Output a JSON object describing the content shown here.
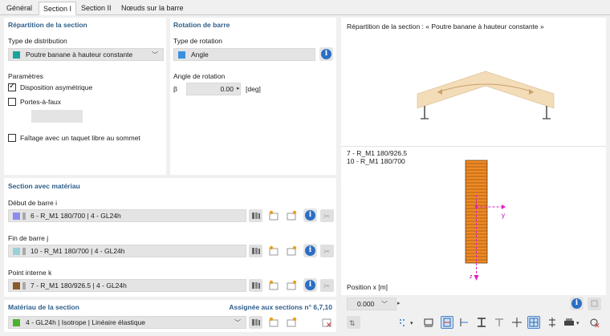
{
  "tabs": [
    "Général",
    "Section I",
    "Section II",
    "Nœuds sur la barre"
  ],
  "distribution": {
    "title": "Répartition de la section",
    "type_label": "Type de distribution",
    "type_value": "Poutre banane à hauteur constante",
    "type_color": "#1aa39a",
    "params_label": "Paramètres",
    "asym_label": "Disposition asymétrique",
    "asym_checked": true,
    "cantilever_label": "Portes-à-faux",
    "cantilever_checked": false,
    "ridge_label": "Faîtage avec un taquet libre au sommet",
    "ridge_checked": false
  },
  "rotation": {
    "title": "Rotation de barre",
    "type_label": "Type de rotation",
    "type_value": "Angle",
    "type_color": "#3b8fe0",
    "angle_label": "Angle de rotation",
    "beta_symbol": "β",
    "angle_value": "0.00",
    "angle_unit": "[deg]"
  },
  "section_material": {
    "title": "Section avec matériau",
    "start_label": "Début de barre i",
    "start_value": "6 - R_M1 180/700 | 4 - GL24h",
    "start_color": "#8c8cf0",
    "end_label": "Fin de barre j",
    "end_value": "10 - R_M1 180/700 | 4 - GL24h",
    "end_color": "#9ad0d8",
    "internal_label": "Point interne k",
    "internal_value": "7 - R_M1 180/926.5 | 4 - GL24h",
    "internal_color": "#8a5a2a"
  },
  "material": {
    "title": "Matériau de la section",
    "assigned": "Assignée aux sections n° 6,7,10",
    "value": "4 - GL24h | Isotrope | Linéaire élastique",
    "color": "#4cb030"
  },
  "preview": {
    "title": "Répartition de la section : « Poutre banane à hauteur constante »",
    "section_line1": "7 - R_M1 180/926.5",
    "section_line2": "10 - R_M1 180/700",
    "axis_y": "y",
    "axis_z": "z",
    "position_label": "Position x [m]",
    "position_value": "0.000"
  }
}
